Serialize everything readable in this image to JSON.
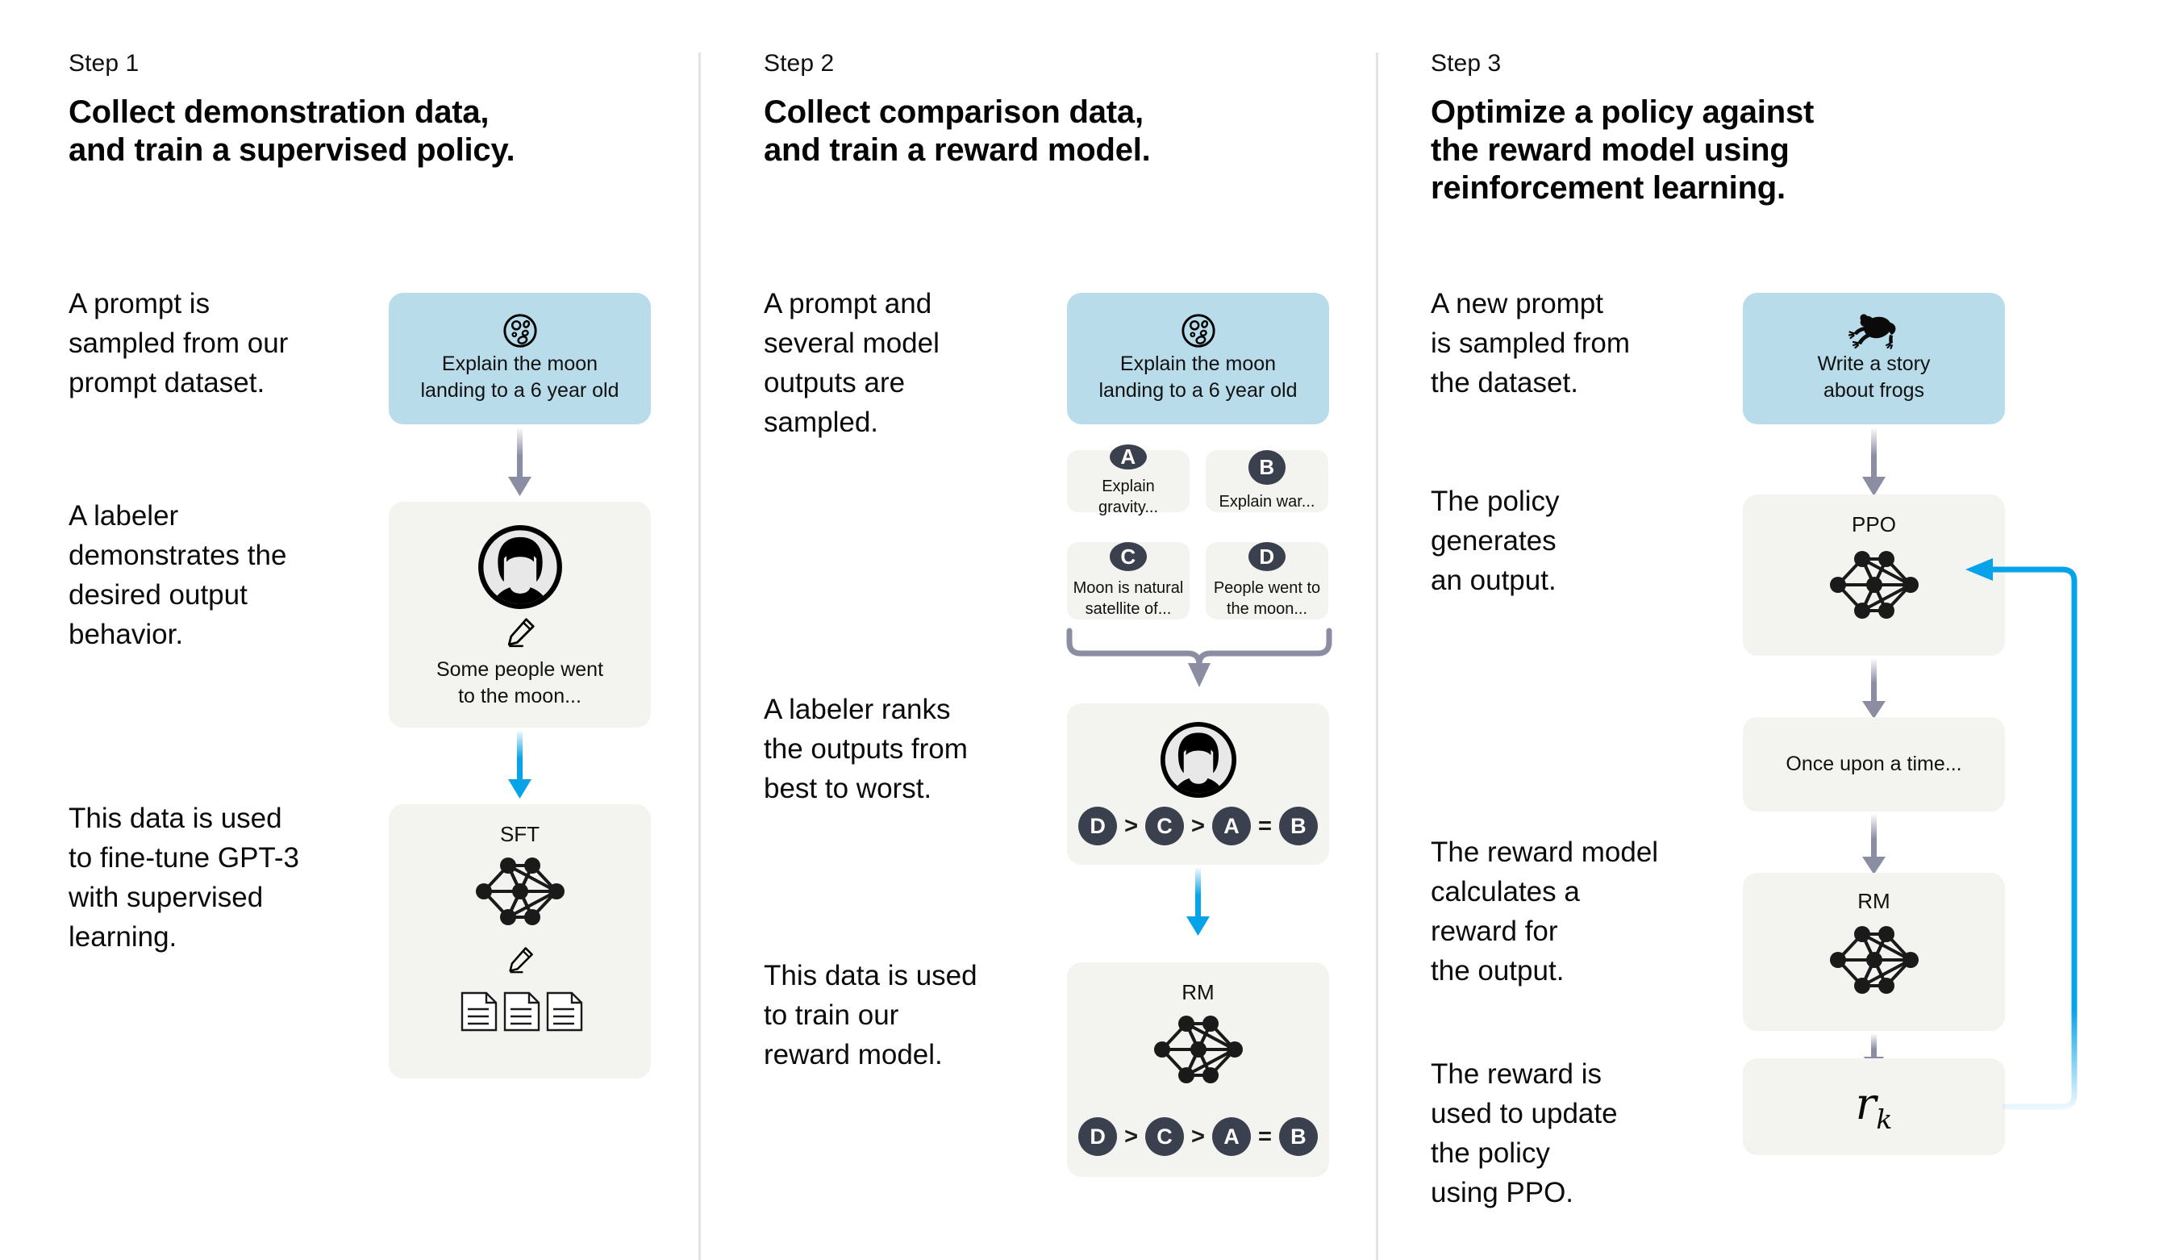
{
  "colors": {
    "prompt_card_bg": "#b9dcea",
    "model_card_bg": "#f3f3ef",
    "arrow_gray": "#8b8da3",
    "arrow_blue": "#07a3e8",
    "badge_dark": "#3b404e",
    "divider": "#e3e3e3",
    "text": "#0d0d0d"
  },
  "steps": [
    {
      "label": "Step 1",
      "title": "Collect demonstration data,\nand train a supervised policy.",
      "paragraphs": [
        "A prompt is\nsampled from our\nprompt dataset.",
        "A labeler\ndemonstrates the\ndesired output\nbehavior.",
        "This data is used\nto fine-tune GPT-3\nwith supervised\nlearning."
      ],
      "cards": {
        "prompt": {
          "icon": "moon-icon",
          "text": "Explain the moon\nlanding to a 6 year old"
        },
        "labeler": {
          "icon": "labeler-avatar-icon",
          "pencil": "pencil-icon",
          "text": "Some people went\nto the moon..."
        },
        "model": {
          "heading": "SFT",
          "icon": "neural-network-icon",
          "pencil": "pencil-icon",
          "docs": "documents-icon"
        }
      }
    },
    {
      "label": "Step 2",
      "title": "Collect comparison data,\nand train a reward model.",
      "paragraphs": [
        "A prompt and\nseveral model\noutputs are\nsampled.",
        "A labeler ranks\nthe outputs from\nbest to worst.",
        "This data is used\nto train our\nreward model."
      ],
      "cards": {
        "prompt": {
          "icon": "moon-icon",
          "text": "Explain the moon\nlanding to a 6 year old"
        },
        "outputs": [
          {
            "badge": "A",
            "text": "Explain gravity..."
          },
          {
            "badge": "B",
            "text": "Explain war..."
          },
          {
            "badge": "C",
            "text": "Moon is natural\nsatellite of..."
          },
          {
            "badge": "D",
            "text": "People went to\nthe moon..."
          }
        ],
        "labeler": {
          "icon": "labeler-avatar-icon",
          "ranking": [
            "D",
            ">",
            "C",
            ">",
            "A",
            "=",
            "B"
          ]
        },
        "reward_model": {
          "heading": "RM",
          "icon": "neural-network-icon",
          "ranking": [
            "D",
            ">",
            "C",
            ">",
            "A",
            "=",
            "B"
          ]
        }
      }
    },
    {
      "label": "Step 3",
      "title": "Optimize a policy against\nthe reward model using\nreinforcement learning.",
      "paragraphs": [
        "A new prompt\nis sampled from\nthe dataset.",
        "The policy\ngenerates\nan output.",
        "The reward model\ncalculates a\nreward for\nthe output.",
        "The reward is\nused to update\nthe policy\nusing PPO."
      ],
      "cards": {
        "prompt": {
          "icon": "frog-icon",
          "text": "Write a story\nabout frogs"
        },
        "policy": {
          "heading": "PPO",
          "icon": "neural-network-icon"
        },
        "output": {
          "text": "Once upon a time..."
        },
        "reward_model": {
          "heading": "RM",
          "icon": "neural-network-icon"
        },
        "reward": {
          "symbol": "r",
          "subscript": "k"
        }
      }
    }
  ]
}
